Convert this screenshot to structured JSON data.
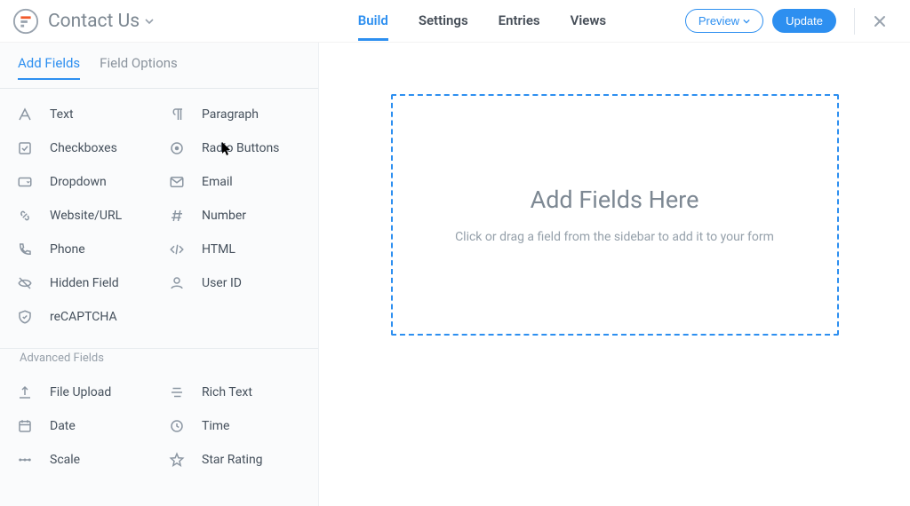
{
  "header": {
    "formName": "Contact Us",
    "nav": {
      "build": "Build",
      "settings": "Settings",
      "entries": "Entries",
      "views": "Views"
    },
    "previewLabel": "Preview",
    "updateLabel": "Update"
  },
  "sidebar": {
    "tabs": {
      "addFields": "Add Fields",
      "fieldOptions": "Field Options"
    },
    "basic": {
      "text": "Text",
      "paragraph": "Paragraph",
      "checkboxes": "Checkboxes",
      "radio": "Radio Buttons",
      "dropdown": "Dropdown",
      "email": "Email",
      "website": "Website/URL",
      "number": "Number",
      "phone": "Phone",
      "html": "HTML",
      "hidden": "Hidden Field",
      "userid": "User ID",
      "recaptcha": "reCAPTCHA"
    },
    "advancedHeader": "Advanced Fields",
    "advanced": {
      "fileupload": "File Upload",
      "richtext": "Rich Text",
      "date": "Date",
      "time": "Time",
      "scale": "Scale",
      "star": "Star Rating"
    }
  },
  "canvas": {
    "heading": "Add Fields Here",
    "hint": "Click or drag a field from the sidebar to add it to your form"
  }
}
